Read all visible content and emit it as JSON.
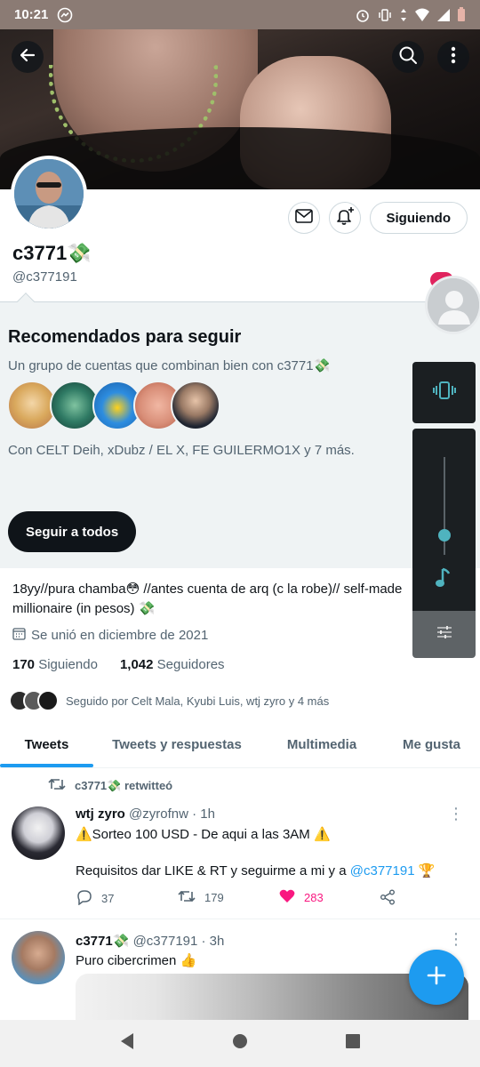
{
  "status_bar": {
    "time": "10:21"
  },
  "profile": {
    "name": "c3771💸",
    "handle": "@c377191",
    "follow_button": "Siguiendo",
    "bio": "18yy//pura chamba😳 //antes cuenta de arq (c la robe)// self-made millionaire (in pesos) 💸",
    "joined": "Se unió en diciembre de 2021",
    "following_count": "170",
    "following_label": "Siguiendo",
    "followers_count": "1,042",
    "followers_label": "Seguidores",
    "followed_by": "Seguido por Celt Mala, Kyubi Luis, wtj zyro y 4 más"
  },
  "recommended": {
    "title": "Recomendados para seguir",
    "subtitle": "Un grupo de cuentas que combinan bien con c3771💸",
    "with_text": "Con CELT Deih, xDubz / EL X, FE GUILERMO1X y 7 más.",
    "follow_all": "Seguir a todos"
  },
  "tabs": [
    {
      "label": "Tweets"
    },
    {
      "label": "Tweets y respuestas"
    },
    {
      "label": "Multimedia"
    },
    {
      "label": "Me gusta"
    }
  ],
  "tweet1": {
    "retweet_by": "c3771💸 retwitteó",
    "name": "wtj zyro",
    "meta": "@zyrofnw · 1h",
    "text1": "⚠️Sorteo 100 USD - De aqui a las 3AM ⚠️",
    "text2_prefix": "Requisitos dar LIKE & RT y seguirme a mi y a ",
    "text2_link": "@c377191",
    "text2_suffix": " 🏆",
    "replies": "37",
    "retweets": "179",
    "likes": "283"
  },
  "tweet2": {
    "name": "c3771💸",
    "meta": "@c377191 · 3h",
    "text": "Puro cibercrimen 👍"
  },
  "colors": {
    "accent": "#1d9bf0",
    "like": "#f91880",
    "volume_accent": "#4fb3bf"
  }
}
